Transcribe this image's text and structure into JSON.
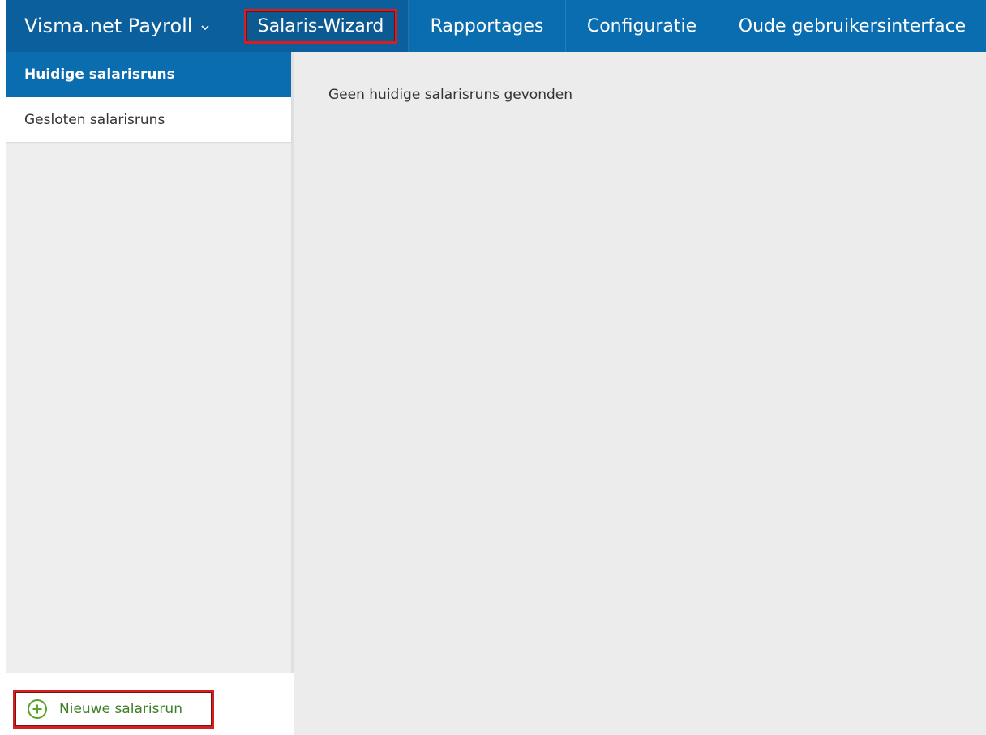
{
  "topnav": {
    "brand": "Visma.net Payroll",
    "items": [
      {
        "label": "Salaris-Wizard",
        "selected": true
      },
      {
        "label": "Rapportages",
        "selected": false
      },
      {
        "label": "Configuratie",
        "selected": false
      },
      {
        "label": "Oude gebruikersinterface",
        "selected": false
      }
    ]
  },
  "sidebar": {
    "items": [
      {
        "label": "Huidige salarisruns",
        "active": true
      },
      {
        "label": "Gesloten salarisruns",
        "active": false
      }
    ],
    "new_run_label": "Nieuwe salarisrun"
  },
  "main": {
    "empty_message": "Geen huidige salarisruns gevonden"
  },
  "colors": {
    "primary": "#0a6db0",
    "highlight_border": "#d42020",
    "add_green": "#3d7f25"
  },
  "icons": {
    "brand_caret": "chevron-down-icon",
    "new_run": "plus-circle-icon"
  }
}
